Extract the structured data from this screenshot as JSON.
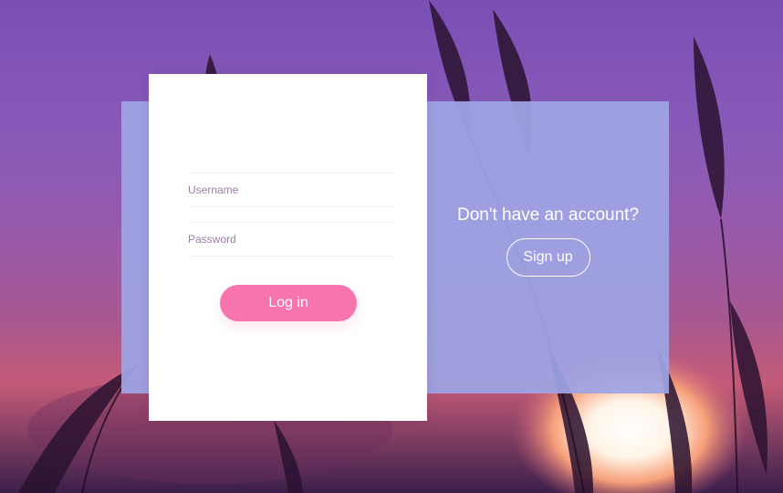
{
  "login": {
    "username_placeholder": "Username",
    "password_placeholder": "Password",
    "login_label": "Log in"
  },
  "signup": {
    "prompt": "Don't have an account?",
    "button_label": "Sign up"
  },
  "colors": {
    "accent": "#f874ae",
    "panel": "#9ea5e4",
    "card": "#ffffff"
  }
}
